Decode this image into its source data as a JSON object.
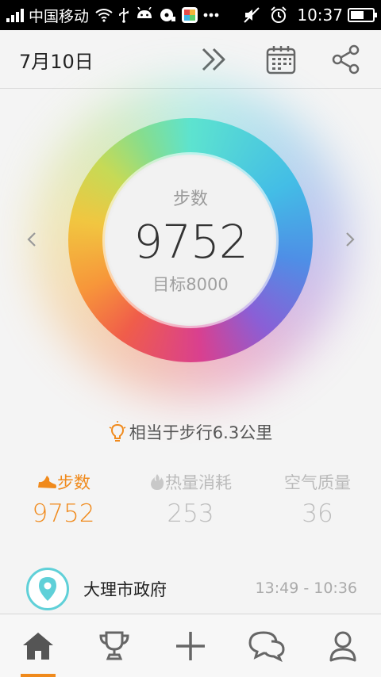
{
  "statusbar": {
    "carrier": "中国移动",
    "time": "10:37"
  },
  "header": {
    "date": "7月10日"
  },
  "ring": {
    "label": "步数",
    "value": "9752",
    "goal": "目标8000"
  },
  "equivalent": {
    "text": "相当于步行6.3公里"
  },
  "stats": [
    {
      "title": "步数",
      "value": "9752",
      "icon": "shoe-icon",
      "active": true
    },
    {
      "title": "热量消耗",
      "value": "253",
      "icon": "flame-icon",
      "active": false
    },
    {
      "title": "空气质量",
      "value": "36",
      "icon": "",
      "active": false
    }
  ],
  "location": {
    "name": "大理市政府",
    "time_range": "13:49 - 10:36"
  },
  "nav": [
    {
      "name": "home",
      "icon": "home-icon",
      "active": true
    },
    {
      "name": "trophy",
      "icon": "trophy-icon",
      "active": false
    },
    {
      "name": "add",
      "icon": "plus-icon",
      "active": false
    },
    {
      "name": "chat",
      "icon": "chat-icon",
      "active": false
    },
    {
      "name": "profile",
      "icon": "user-icon",
      "active": false
    }
  ],
  "colors": {
    "accent": "#f08a1c",
    "pin": "#5fd0d8"
  }
}
